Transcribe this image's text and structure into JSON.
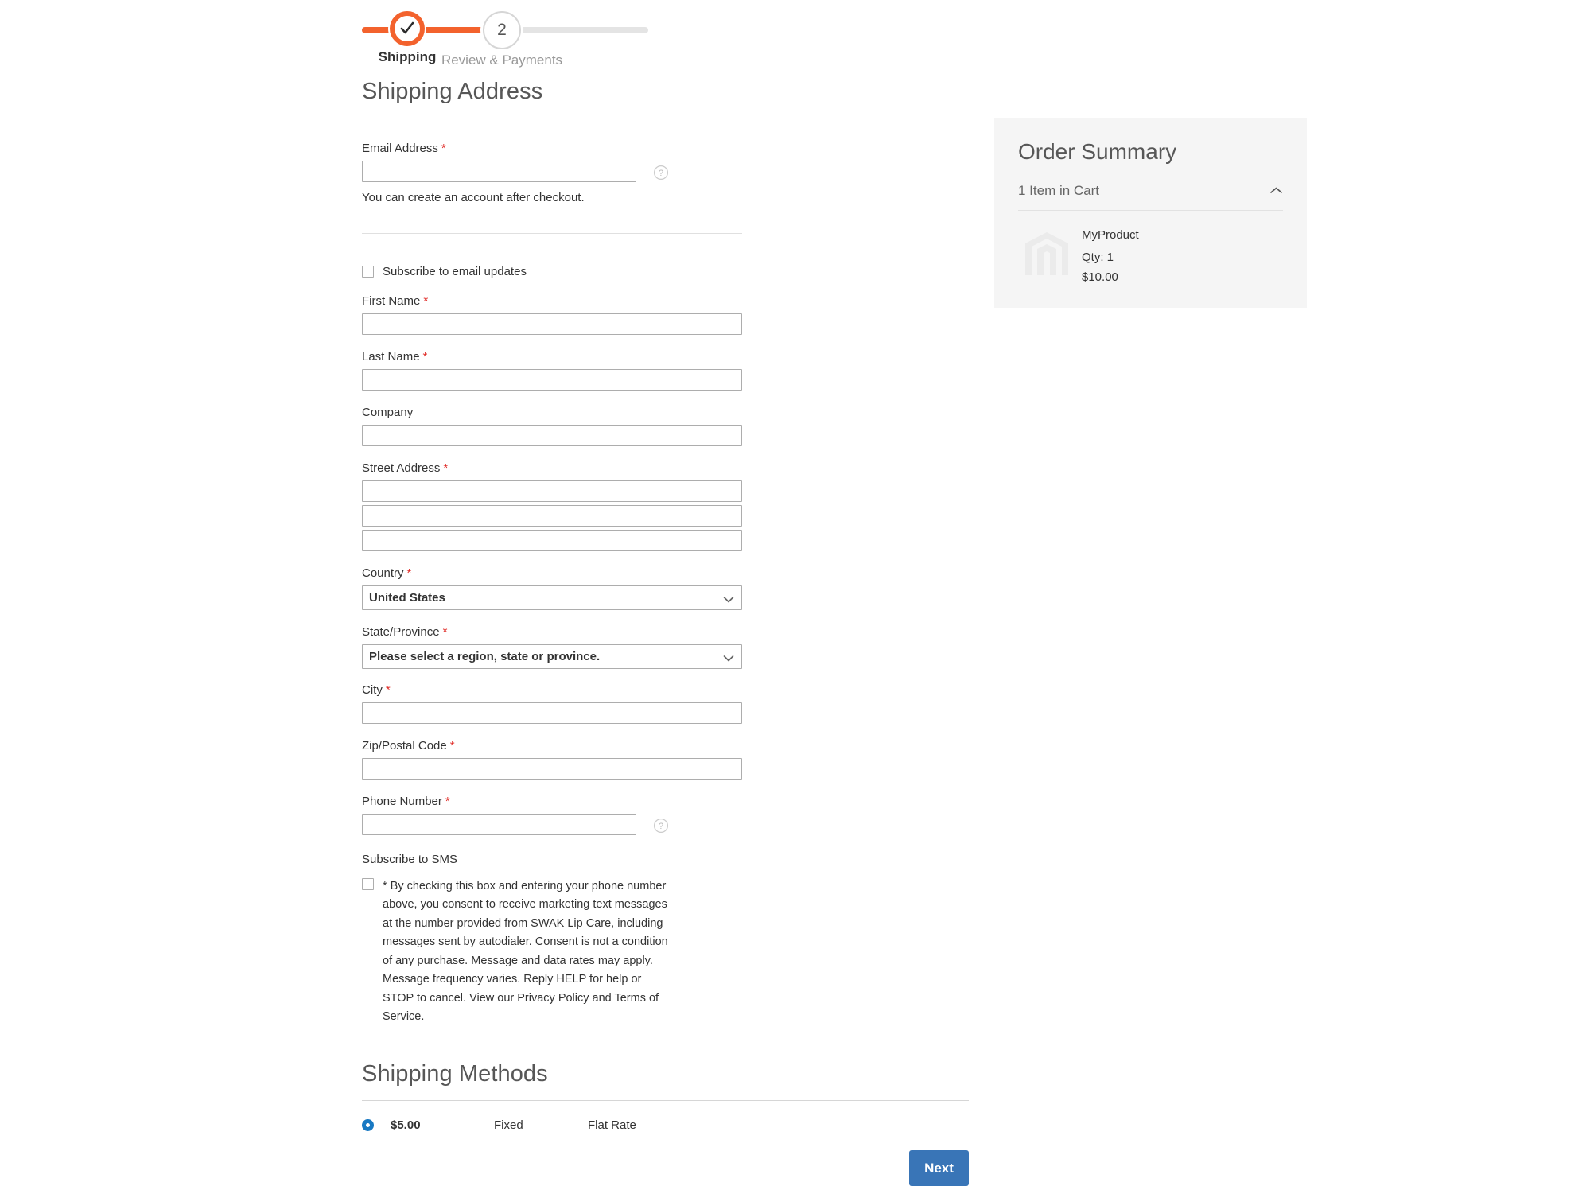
{
  "progress": {
    "step1": {
      "label": "Shipping",
      "state": "complete",
      "icon": "check-icon"
    },
    "step2": {
      "label": "Review & Payments",
      "number": "2",
      "state": "upcoming"
    },
    "accent_color": "#f3622d",
    "track_color": "#e4e4e4"
  },
  "shipping_address": {
    "heading": "Shipping Address",
    "email": {
      "label": "Email Address",
      "required": "*",
      "value": "",
      "placeholder": "",
      "hint": "You can create an account after checkout.",
      "tooltip_icon": "help-circle-icon"
    },
    "subscribe_email": {
      "label": "Subscribe to email updates",
      "checked": false
    },
    "fields": [
      {
        "name": "first-name",
        "label": "First Name",
        "required": "*",
        "value": "",
        "type": "text"
      },
      {
        "name": "last-name",
        "label": "Last Name",
        "required": "*",
        "value": "",
        "type": "text"
      },
      {
        "name": "company",
        "label": "Company",
        "required": "",
        "value": "",
        "type": "text"
      }
    ],
    "street": {
      "label": "Street Address",
      "required": "*",
      "lines": [
        "",
        "",
        ""
      ]
    },
    "country": {
      "label": "Country",
      "required": "*",
      "selected": "United States",
      "options": [
        "United States"
      ],
      "icon": "chevron-down-icon"
    },
    "state": {
      "label": "State/Province",
      "required": "*",
      "selected": "Please select a region, state or province.",
      "options": [
        "Please select a region, state or province."
      ],
      "icon": "chevron-down-icon"
    },
    "city": {
      "label": "City",
      "required": "*",
      "value": ""
    },
    "zip": {
      "label": "Zip/Postal Code",
      "required": "*",
      "value": ""
    },
    "phone": {
      "label": "Phone Number",
      "required": "*",
      "value": "",
      "tooltip_icon": "help-circle-icon"
    },
    "sms": {
      "title": "Subscribe to SMS",
      "checked": false,
      "consent": "* By checking this box and entering your phone number above, you consent to receive marketing text messages at the number provided from SWAK Lip Care, including messages sent by autodialer. Consent is not a condition of any purchase. Message and data rates may apply. Message frequency varies. Reply HELP for help or STOP to cancel. View our Privacy Policy and Terms of Service."
    }
  },
  "shipping_methods": {
    "heading": "Shipping Methods",
    "rows": [
      {
        "selected": true,
        "price": "$5.00",
        "method": "Fixed",
        "carrier": "Flat Rate"
      }
    ]
  },
  "actions": {
    "next_label": "Next",
    "next_color": "#3975b7"
  },
  "order_summary": {
    "title": "Order Summary",
    "cart_count_label": "1 Item in Cart",
    "toggle_icon": "chevron-up-icon",
    "items": [
      {
        "name": "MyProduct",
        "qty_label": "Qty: 1",
        "price": "$10.00",
        "image": "product-placeholder-icon"
      }
    ]
  }
}
